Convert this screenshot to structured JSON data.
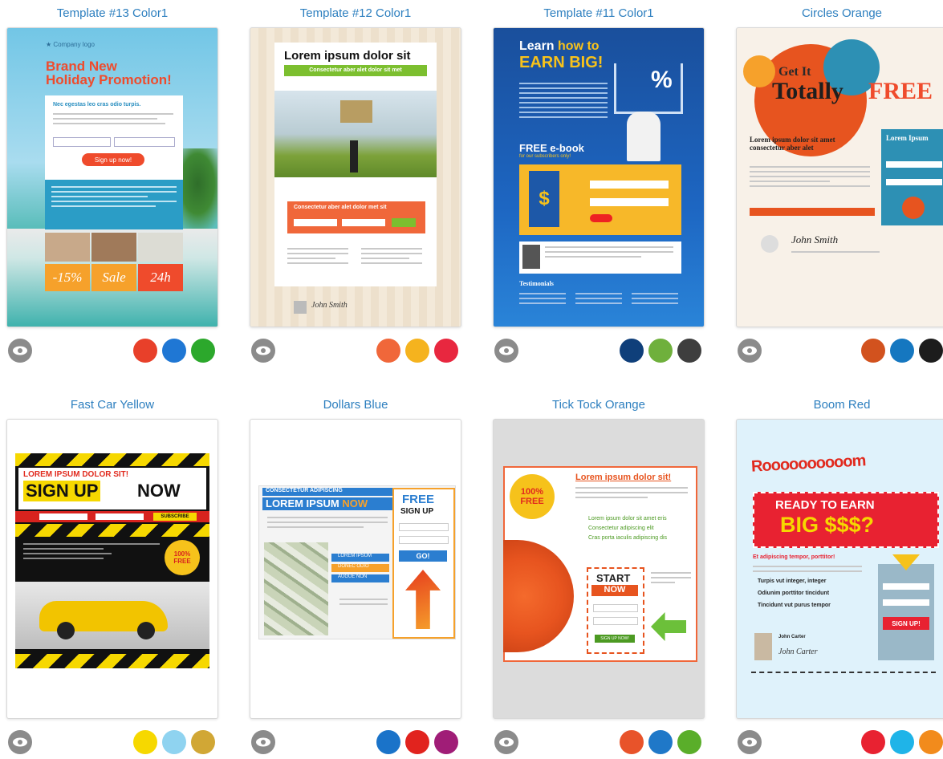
{
  "templates": [
    {
      "title": "Template #13 Color1",
      "swatches": [
        "#e8402a",
        "#1f77d4",
        "#2ca82c"
      ],
      "preview": {
        "headline1": "Brand New",
        "headline2": "Holiday Promotion!",
        "form_title": "Nec egestas leo cras odio turpis.",
        "cta": "Sign up now!",
        "badges": [
          "-15%",
          "Sale",
          "24h"
        ]
      }
    },
    {
      "title": "Template #12 Color1",
      "swatches": [
        "#f0673a",
        "#f5b31e",
        "#e8273f"
      ],
      "preview": {
        "headline": "Lorem ipsum dolor sit",
        "subheadline": "Consectetur aber alet dolor sit met",
        "form_title": "Consectetur aber alet dolor met sit",
        "signature": "John Smith"
      }
    },
    {
      "title": "Template #11 Color1",
      "swatches": [
        "#0f3f7a",
        "#6fb03c",
        "#3e3e3e"
      ],
      "preview": {
        "headline1": "Learn",
        "headline1b": "how to",
        "headline2": "EARN BIG!",
        "ebook": "FREE e-book",
        "ebook_sub": "for our subscribers only!",
        "section": "Testimonials"
      }
    },
    {
      "title": "Circles Orange",
      "swatches": [
        "#d2521e",
        "#1577c0",
        "#1c1c1c"
      ],
      "preview": {
        "get_it": "Get It",
        "totally": "Totally",
        "free": "FREE",
        "body_title": "Lorem ipsum dolor sit amet consectetur aber alet",
        "sidebar_title": "Lorem Ipsum",
        "signature": "John Smith"
      }
    },
    {
      "title": "Fast Car Yellow",
      "swatches": [
        "#f6d800",
        "#8fd3f0",
        "#d1a735"
      ],
      "preview": {
        "headline": "LOREM IPSUM DOLOR SIT!",
        "signup": "SIGN UP",
        "now": "NOW",
        "subscribe": "SUBSCRIBE",
        "badge1": "100%",
        "badge2": "FREE"
      }
    },
    {
      "title": "Dollars Blue",
      "swatches": [
        "#1a73c9",
        "#e1231e",
        "#a01d77"
      ],
      "preview": {
        "kicker": "CONSECTETUR ADIPISCING",
        "headline": "LOREM IPSUM",
        "headline_accent": "NOW",
        "free": "FREE",
        "signup": "SIGN UP",
        "list": [
          "LOREM IPSUM",
          "DONEC ODIO",
          "AUGUE NON"
        ],
        "go": "GO!"
      }
    },
    {
      "title": "Tick Tock Orange",
      "swatches": [
        "#e8532a",
        "#1f78c8",
        "#5aae2a"
      ],
      "preview": {
        "headline": "Lorem ipsum dolor sit!",
        "badge1": "100%",
        "badge2": "FREE",
        "bullets": [
          "Lorem ipsum dolor sit amet eris",
          "Consectetur adipiscing elit",
          "Cras porta iaculis adipiscing dis"
        ],
        "start": "START",
        "now": "NOW",
        "signup": "SIGN UP NOW!"
      }
    },
    {
      "title": "Boom Red",
      "swatches": [
        "#e82231",
        "#1fb4e8",
        "#f28b1c"
      ],
      "preview": {
        "boom": "Roooooooooom",
        "ready": "READY TO EARN",
        "big": "BIG $$$?",
        "subtitle": "Et adipiscing tempor, porttitor!",
        "bullets": [
          "Turpis vut integer, integer",
          "Odiunim porttitor tincidunt",
          "Tincidunt vut purus tempor"
        ],
        "signup": "SIGN UP!",
        "name": "John Carter",
        "signature": "John Carter"
      }
    }
  ]
}
